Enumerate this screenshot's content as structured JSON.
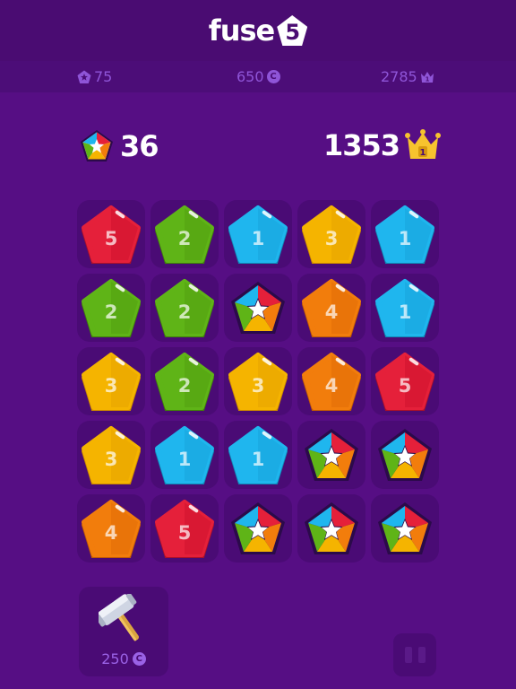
{
  "header": {
    "logo_text": "fuse",
    "logo_number": "5"
  },
  "stats": {
    "gems": "75",
    "coins": "650",
    "best": "2785",
    "best_badge": "1",
    "coin_symbol": "C"
  },
  "score": {
    "moves": "36",
    "best": "1353",
    "crown_badge": "1"
  },
  "colors": {
    "background": "#560e84",
    "cell": "#4a0b75",
    "red": "#e5203a",
    "green": "#5fb417",
    "blue": "#1fb6ee",
    "yellow": "#f5b400",
    "orange": "#f27d0c",
    "gold": "#f7c32e"
  },
  "grid": [
    [
      {
        "color": "red",
        "number": "5"
      },
      {
        "color": "green",
        "number": "2"
      },
      {
        "color": "blue",
        "number": "1"
      },
      {
        "color": "yellow",
        "number": "3"
      },
      {
        "color": "blue",
        "number": "1"
      }
    ],
    [
      {
        "color": "green",
        "number": "2"
      },
      {
        "color": "green",
        "number": "2"
      },
      {
        "color": "star",
        "number": ""
      },
      {
        "color": "orange",
        "number": "4"
      },
      {
        "color": "blue",
        "number": "1"
      }
    ],
    [
      {
        "color": "yellow",
        "number": "3"
      },
      {
        "color": "green",
        "number": "2"
      },
      {
        "color": "yellow",
        "number": "3"
      },
      {
        "color": "orange",
        "number": "4"
      },
      {
        "color": "red",
        "number": "5"
      }
    ],
    [
      {
        "color": "yellow",
        "number": "3"
      },
      {
        "color": "blue",
        "number": "1"
      },
      {
        "color": "blue",
        "number": "1"
      },
      {
        "color": "star",
        "number": ""
      },
      {
        "color": "star",
        "number": ""
      }
    ],
    [
      {
        "color": "orange",
        "number": "4"
      },
      {
        "color": "red",
        "number": "5"
      },
      {
        "color": "star",
        "number": ""
      },
      {
        "color": "star",
        "number": ""
      },
      {
        "color": "star",
        "number": ""
      }
    ]
  ],
  "powerup": {
    "name": "hammer-icon",
    "cost": "250"
  },
  "controls": {
    "pause_icon": "pause-icon"
  }
}
